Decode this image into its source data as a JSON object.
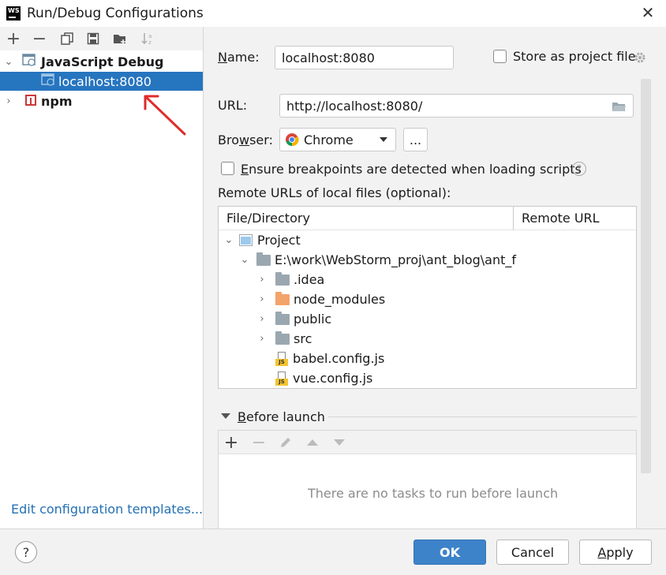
{
  "window": {
    "title": "Run/Debug Configurations",
    "logo_text": "WS"
  },
  "left": {
    "toolbar_icons": [
      "add-icon",
      "remove-icon",
      "copy-icon",
      "save-icon",
      "new-folder-icon",
      "sort-icon"
    ],
    "tree": [
      {
        "label": "JavaScript Debug",
        "bold": true,
        "expanded": true
      },
      {
        "label": "localhost:8080",
        "selected": true
      },
      {
        "label": "npm",
        "bold": true,
        "expanded": false
      }
    ],
    "edit_templates_link": "Edit configuration templates..."
  },
  "form": {
    "name_label": "Name:",
    "name_value": "localhost:8080",
    "store_label": "Store as project file",
    "url_label": "URL:",
    "url_value": "http://localhost:8080/",
    "browser_label": "Browser:",
    "browser_value": "Chrome",
    "browse_button": "...",
    "ensure_label": "Ensure breakpoints are detected when loading scripts",
    "remote_urls_label": "Remote URLs of local files (optional):"
  },
  "table": {
    "columns": [
      "File/Directory",
      "Remote URL"
    ],
    "rows": [
      {
        "label": "Project"
      },
      {
        "label": "E:\\work\\WebStorm_proj\\ant_blog\\ant_f"
      },
      {
        "label": ".idea"
      },
      {
        "label": "node_modules"
      },
      {
        "label": "public"
      },
      {
        "label": "src"
      },
      {
        "label": "babel.config.js"
      },
      {
        "label": "vue.config.js"
      }
    ]
  },
  "before_launch": {
    "title": "Before launch",
    "empty_text": "There are no tasks to run before launch"
  },
  "footer": {
    "ok": "OK",
    "cancel": "Cancel",
    "apply": "Apply",
    "help": "?"
  },
  "colors": {
    "selection": "#2675bf",
    "ok_button": "#3d83c9",
    "link": "#2470b3",
    "arrow": "#e02b2b"
  }
}
